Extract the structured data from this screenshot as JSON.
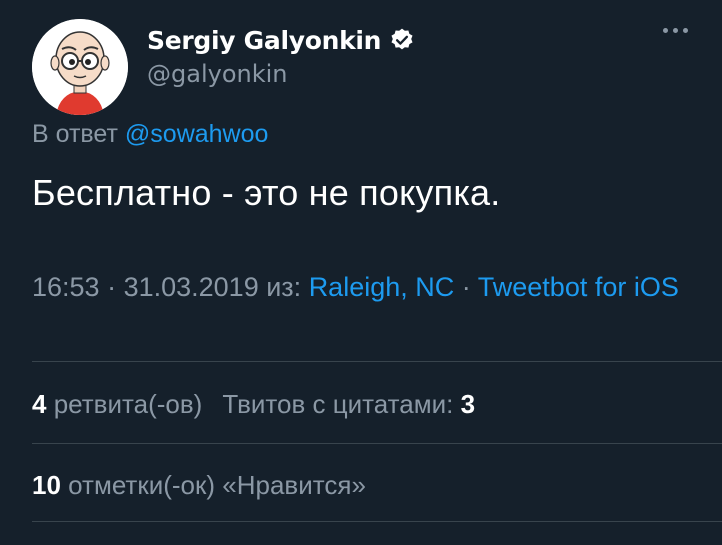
{
  "author": {
    "display_name": "Sergiy Galyonkin",
    "handle": "@galyonkin",
    "verified": true
  },
  "reply": {
    "prefix": "В ответ",
    "mention": "@sowahwoo"
  },
  "tweet": {
    "text": "Бесплатно - это не покупка."
  },
  "meta": {
    "time": "16:53",
    "sep1": " · ",
    "date": "31.03.2019",
    "from_label": " из: ",
    "location": "Raleigh, NC",
    "sep2": " · ",
    "client": "Tweetbot for iOS"
  },
  "stats": {
    "retweets_count": "4",
    "retweets_label": "ретвита(-ов)",
    "quotes_label": "Твитов с цитатами:",
    "quotes_count": "3",
    "likes_count": "10",
    "likes_label": "отметки(-ок) «Нравится»"
  },
  "colors": {
    "background": "#15202b",
    "accent": "#1d9bf0",
    "secondary_text": "#8b98a5",
    "divider": "#38444d"
  },
  "icons": {
    "avatar": "cartoon-face-avatar",
    "verified": "verified-badge-icon",
    "more": "more-options-icon"
  }
}
